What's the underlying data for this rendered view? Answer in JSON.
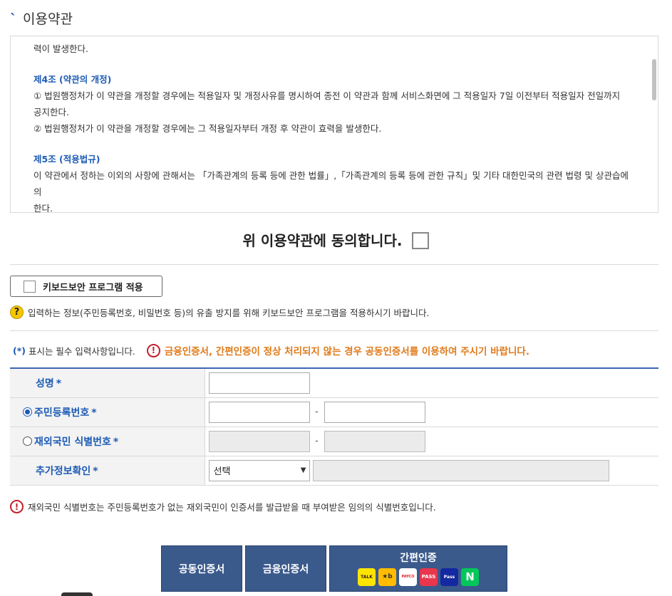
{
  "section": {
    "title": "이용약관"
  },
  "terms": {
    "lines": [
      "력이 발생한다.",
      "제4조 (약관의 개정)",
      "① 법원행정처가 이 약관을 개정할 경우에는 적용일자 및 개정사유를 명시하여 종전 이 약관과 함께 서비스화면에 그 적용일자 7일 이전부터 적용일자 전일까지",
      "공지한다.",
      "② 법원행정처가 이 약관을 개정할 경우에는 그 적용일자부터 개정 후 약관이 효력을 발생한다.",
      "제5조 (적용법규)",
      "이 약관에서 정하는 이외의 사항에 관해서는 「가족관계의 등록 등에 관한 법률」,「가족관계의 등록 등에 관한 규칙」및 기타 대한민국의 관련 법령 및 상관습에 의",
      "한다."
    ]
  },
  "agree": {
    "label": "위 이용약관에 동의합니다."
  },
  "keyboard": {
    "button_label": "키보드보안 프로그램 적용",
    "info": "입력하는 정보(주민등록번호, 비밀번호 등)의 유출 방지를 위해 키보드보안 프로그램을 적용하시기 바랍니다."
  },
  "required": {
    "mark": "(*)",
    "text": "표시는 필수 입력사항입니다.",
    "warning": "금융인증서, 간편인증이 정상 처리되지 않는 경우 공동인증서를 이용하여 주시기 바랍니다."
  },
  "form": {
    "name_label": "성명",
    "rrn_label": "주민등록번호",
    "foreign_label": "재외국민 식별번호",
    "extra_label": "추가정보확인",
    "star": "*",
    "dash": "-",
    "select_value": "선택",
    "select_arrow": "▼"
  },
  "note": "재외국민 식별번호는 주민등록번호가 없는 재외국민이 인증서를 발급받을 때 부여받은 임의의 식별번호입니다.",
  "buttons": {
    "joint_cert": "공동인증서",
    "finance_cert": "금융인증서",
    "simple_auth": "간편인증",
    "icons": [
      "kakao-talk",
      "kb",
      "payco",
      "pass",
      "samsung-pass",
      "naver"
    ],
    "icon_texts": {
      "kakao": "TALK",
      "kb": "★b",
      "payco": "PAYCO",
      "pass": "PASS",
      "samsung": "Pass",
      "naver": "N"
    }
  },
  "colors": {
    "accent": "#1d5bb5",
    "button": "#3b5a8c",
    "warning_text": "#e07a1a",
    "warning_icon": "#c4212b",
    "question_icon": "#f6c700"
  }
}
